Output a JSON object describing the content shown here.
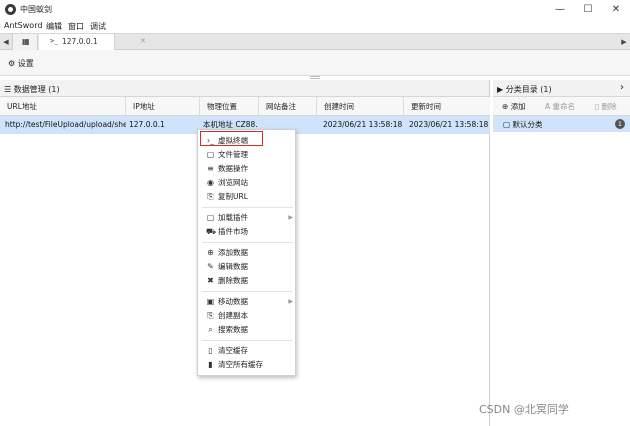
{
  "window": {
    "title": "中国蚁剑",
    "controls": {
      "minimize": "—",
      "maximize": "☐",
      "close": "✕"
    }
  },
  "menubar": [
    "AntSword",
    "编辑",
    "窗口",
    "调试"
  ],
  "tabs": {
    "nav_left": "◀",
    "nav_right": "▶",
    "home_icon": "▦",
    "items": [
      {
        "icon": ">_",
        "label": "127.0.0.1",
        "close": "✕"
      }
    ]
  },
  "toolbar": {
    "settings_label": "设置",
    "settings_icon": "⚙"
  },
  "left_panel": {
    "header_icon": "☰",
    "header": "数据管理 (1)",
    "columns": [
      "URL地址",
      "IP地址",
      "物理位置",
      "网站备注",
      "创建时间",
      "更新时间"
    ],
    "rows": [
      {
        "url": "http://test/FileUpload/upload/shel",
        "ip": "127.0.0.1",
        "location": "本机地址 CZ88.",
        "note": "",
        "created": "2023/06/21 13:58:18",
        "updated": "2023/06/21 13:58:18"
      }
    ]
  },
  "context_menu": {
    "items": [
      {
        "icon": "›_",
        "label": "虚拟终端"
      },
      {
        "icon": "▢",
        "label": "文件管理"
      },
      {
        "icon": "≡",
        "label": "数据操作"
      },
      {
        "icon": "◉",
        "label": "浏览网站"
      },
      {
        "icon": "⎘",
        "label": "复制URL"
      },
      {
        "icon": "▢",
        "label": "加载插件",
        "arrow": "▶"
      },
      {
        "icon": "⛟",
        "label": "插件市场"
      },
      {
        "icon": "⊕",
        "label": "添加数据"
      },
      {
        "icon": "✎",
        "label": "编辑数据"
      },
      {
        "icon": "✖",
        "label": "删除数据"
      },
      {
        "icon": "▣",
        "label": "移动数据",
        "arrow": "▶"
      },
      {
        "icon": "⎘",
        "label": "创建副本"
      },
      {
        "icon": "⌕",
        "label": "搜索数据"
      },
      {
        "icon": "▯",
        "label": "清空缓存"
      },
      {
        "icon": "▮",
        "label": "清空所有缓存"
      }
    ]
  },
  "right_panel": {
    "header_icon": "▶",
    "header": "分类目录 (1)",
    "expand_icon": "›",
    "tools": {
      "add": {
        "icon": "⊕",
        "label": "添加"
      },
      "rename": {
        "icon": "A",
        "label": "重命名"
      },
      "delete": {
        "icon": "▯",
        "label": "删除"
      }
    },
    "categories": [
      {
        "icon": "▢",
        "label": "默认分类",
        "count": "1"
      }
    ]
  },
  "watermark": "CSDN @北冥同学",
  "colors": {
    "selection": "#cfe3fb",
    "highlight_box": "#d62b2b"
  }
}
